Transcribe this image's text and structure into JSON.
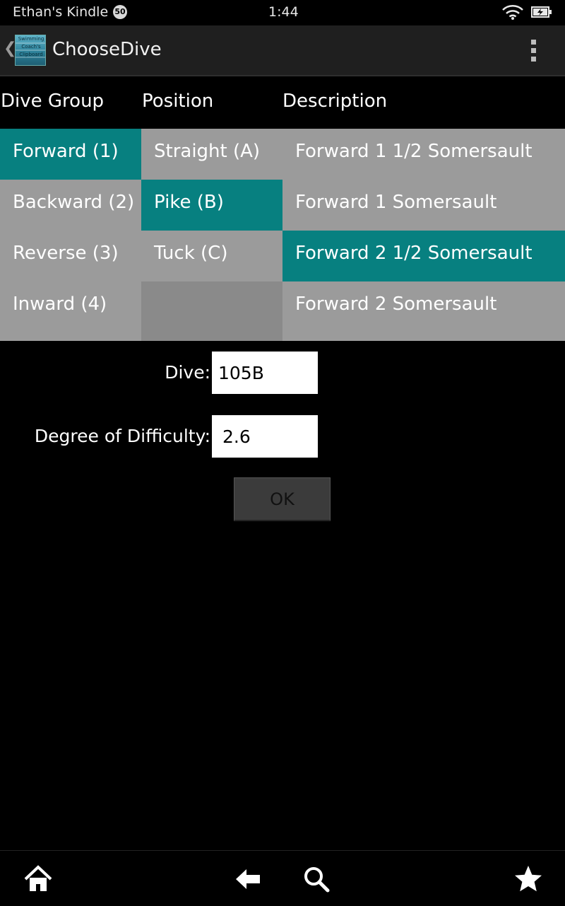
{
  "status_bar": {
    "device_name": "Ethan's Kindle",
    "notification_count": "50",
    "time": "1:44",
    "icons": [
      "wifi-icon",
      "battery-charging-icon"
    ]
  },
  "action_bar": {
    "title": "ChooseDive",
    "logo_text": "Swimming Coach's Clipboard",
    "icons": [
      "back-chevron-icon",
      "app-logo",
      "overflow-menu-icon"
    ]
  },
  "columns": {
    "headers": [
      "Dive Group",
      "Position",
      "Description"
    ]
  },
  "dive_groups": [
    {
      "label": "Forward (1)",
      "selected": true
    },
    {
      "label": "Backward (2)",
      "selected": false
    },
    {
      "label": "Reverse (3)",
      "selected": false
    },
    {
      "label": "Inward (4)",
      "selected": false
    }
  ],
  "positions": [
    {
      "label": "Straight (A)",
      "selected": false
    },
    {
      "label": "Pike (B)",
      "selected": true
    },
    {
      "label": "Tuck (C)",
      "selected": false
    }
  ],
  "descriptions": [
    {
      "label": "Forward 1 1/2 Somersault",
      "selected": false
    },
    {
      "label": "Forward 1 Somersault",
      "selected": false
    },
    {
      "label": "Forward 2 1/2 Somersault",
      "selected": true
    },
    {
      "label": "Forward 2 Somersault",
      "selected": false
    }
  ],
  "form": {
    "dive_label": "Dive:",
    "dive_value": "105B",
    "difficulty_label": "Degree of Difficulty:",
    "difficulty_value": "2.6",
    "ok_label": "OK"
  },
  "bottom_nav": {
    "icons": [
      "home-icon",
      "back-arrow-icon",
      "search-icon",
      "favorites-star-icon"
    ]
  },
  "colors": {
    "selected": "#078080",
    "cell_background": "#9b9b9b",
    "background": "#000000",
    "action_bar": "#1f1f1f"
  }
}
